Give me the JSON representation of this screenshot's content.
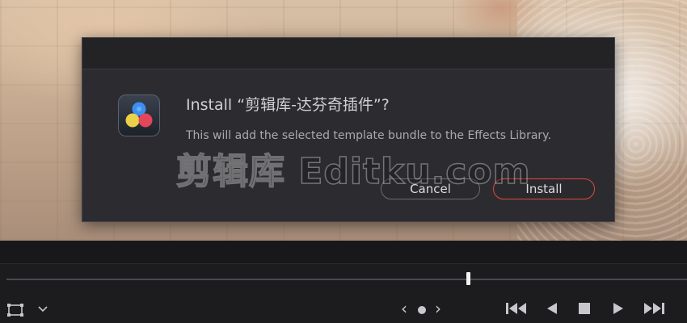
{
  "dialog": {
    "title": "Install “剪辑库-达芬奇插件”?",
    "message": "This will add the selected template bundle to the Effects Library.",
    "cancel_label": "Cancel",
    "install_label": "Install",
    "app_icon": "davinci-resolve-icon"
  },
  "watermark": {
    "text": "剪辑库  Editku.com"
  },
  "player": {
    "icons": [
      "crop-icon",
      "chevron-down-icon",
      "previous-icon",
      "dot-icon",
      "next-icon",
      "skip-to-start-icon",
      "play-reverse-icon",
      "stop-icon",
      "play-icon",
      "skip-to-end-icon"
    ],
    "prev_glyph": "‹",
    "next_glyph": "›"
  },
  "colors": {
    "dialog_bg": "#2c2c30",
    "install_border": "#e0463f",
    "text_primary": "#cfcfd4"
  }
}
